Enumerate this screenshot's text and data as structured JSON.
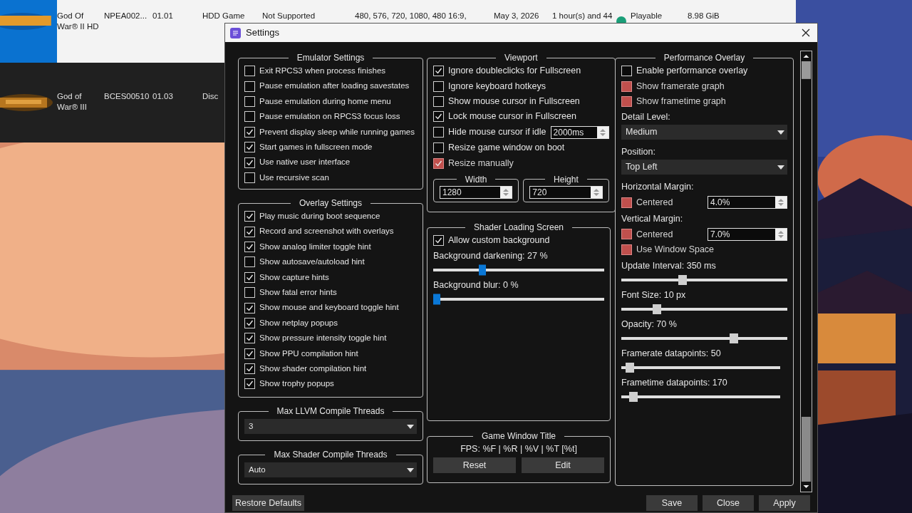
{
  "game_list": {
    "rows": [
      {
        "selected": true,
        "cells": [
          "God Of War® II HD",
          "NPEA002...",
          "01.01",
          "HDD Game",
          "Not Supported",
          "480, 576, 720, 1080, 480 16:9,",
          "May 3, 2026",
          "1 hour(s) and 44",
          "Playable",
          "8.98 GiB"
        ]
      },
      {
        "selected": false,
        "cells": [
          "God of War® III",
          "BCES00510",
          "01.03",
          "Disc"
        ]
      }
    ]
  },
  "window": {
    "title": "Settings"
  },
  "emulator_settings": {
    "title": "Emulator Settings",
    "items": [
      {
        "label": "Exit RPCS3 when process finishes",
        "checked": false
      },
      {
        "label": "Pause emulation after loading savestates",
        "checked": false
      },
      {
        "label": "Pause emulation during home menu",
        "checked": false
      },
      {
        "label": "Pause emulation on RPCS3 focus loss",
        "checked": false
      },
      {
        "label": "Prevent display sleep while running games",
        "checked": true
      },
      {
        "label": "Start games in fullscreen mode",
        "checked": true
      },
      {
        "label": "Use native user interface",
        "checked": true
      },
      {
        "label": "Use recursive scan",
        "checked": false
      }
    ]
  },
  "overlay_settings": {
    "title": "Overlay Settings",
    "items": [
      {
        "label": "Play music during boot sequence",
        "checked": true
      },
      {
        "label": "Record and screenshot with overlays",
        "checked": true
      },
      {
        "label": "Show analog limiter toggle hint",
        "checked": true
      },
      {
        "label": "Show autosave/autoload hint",
        "checked": false
      },
      {
        "label": "Show capture hints",
        "checked": true
      },
      {
        "label": "Show fatal error hints",
        "checked": false
      },
      {
        "label": "Show mouse and keyboard toggle hint",
        "checked": true
      },
      {
        "label": "Show netplay popups",
        "checked": true
      },
      {
        "label": "Show pressure intensity toggle hint",
        "checked": true
      },
      {
        "label": "Show PPU compilation hint",
        "checked": true
      },
      {
        "label": "Show shader compilation hint",
        "checked": true
      },
      {
        "label": "Show trophy popups",
        "checked": true
      }
    ]
  },
  "llvm_threads": {
    "title": "Max LLVM Compile Threads",
    "value": "3"
  },
  "shader_threads": {
    "title": "Max Shader Compile Threads",
    "value": "Auto"
  },
  "viewport": {
    "title": "Viewport",
    "items": [
      {
        "kind": "checkbox",
        "label": "Ignore doubleclicks for Fullscreen",
        "checked": true,
        "disabled": false
      },
      {
        "kind": "checkbox",
        "label": "Ignore keyboard hotkeys",
        "checked": false,
        "disabled": false
      },
      {
        "kind": "checkbox",
        "label": "Show mouse cursor in Fullscreen",
        "checked": false,
        "disabled": false
      },
      {
        "kind": "checkbox",
        "label": "Lock mouse cursor in Fullscreen",
        "checked": true,
        "disabled": false
      },
      {
        "kind": "checkbox_spin",
        "label": "Hide mouse cursor if idle",
        "checked": false,
        "disabled": false,
        "value": "2000ms"
      },
      {
        "kind": "checkbox",
        "label": "Resize game window on boot",
        "checked": false,
        "disabled": false
      },
      {
        "kind": "checkbox",
        "label": "Resize manually",
        "checked": true,
        "disabled": true
      }
    ],
    "size_fields": [
      {
        "title": "Width",
        "value": "1280"
      },
      {
        "title": "Height",
        "value": "720"
      }
    ]
  },
  "shader_loading": {
    "title": "Shader Loading Screen",
    "items": [
      {
        "kind": "checkbox",
        "label": "Allow custom background",
        "checked": true,
        "disabled": false
      },
      {
        "kind": "slider",
        "label": "Background darkening: 27 %",
        "level": 0.28,
        "disabled": false
      },
      {
        "kind": "slider",
        "label": "Background blur: 0 %",
        "level": 0,
        "disabled": false
      }
    ]
  },
  "game_window_title": {
    "title": "Game Window Title",
    "format": "FPS: %F | %R | %V | %T [%t]",
    "buttons": [
      "Reset",
      "Edit"
    ]
  },
  "performance_overlay": {
    "title": "Performance Overlay",
    "items": [
      {
        "kind": "checkbox",
        "label": "Enable performance overlay",
        "checked": false,
        "disabled": false
      },
      {
        "kind": "checkbox",
        "label": "Show framerate graph",
        "checked": false,
        "disabled": true
      },
      {
        "kind": "checkbox",
        "label": "Show frametime graph",
        "checked": false,
        "disabled": true
      },
      {
        "kind": "caption",
        "text": "Detail Level:"
      },
      {
        "kind": "dropdown",
        "value": "Medium"
      },
      {
        "kind": "caption",
        "text": "Position:"
      },
      {
        "kind": "dropdown",
        "value": "Top Left"
      },
      {
        "kind": "caption",
        "text": "Horizontal Margin:"
      },
      {
        "kind": "checkbox_spin",
        "label": "Centered",
        "checked": false,
        "disabled": true,
        "value": "4.0%"
      },
      {
        "kind": "caption",
        "text": "Vertical Margin:"
      },
      {
        "kind": "checkbox_spin",
        "label": "Centered",
        "checked": false,
        "disabled": true,
        "value": "7.0%"
      },
      {
        "kind": "checkbox",
        "label": "Use Window Space",
        "checked": false,
        "disabled": true
      },
      {
        "kind": "slider",
        "label": "Update Interval: 350 ms",
        "level": 0.36,
        "disabled": true
      },
      {
        "kind": "slider",
        "label": "Font Size: 10 px",
        "level": 0.2,
        "disabled": true
      },
      {
        "kind": "slider",
        "label": "Opacity: 70 %",
        "level": 0.69,
        "disabled": true
      },
      {
        "kind": "slider",
        "label": "Framerate datapoints: 50",
        "level": 0.03,
        "disabled": true
      },
      {
        "kind": "slider",
        "label": "Frametime datapoints: 170",
        "level": 0.05,
        "disabled": true
      }
    ]
  },
  "footer": {
    "restore_button": "Restore Defaults",
    "buttons": [
      "Save",
      "Close",
      "Apply"
    ]
  }
}
